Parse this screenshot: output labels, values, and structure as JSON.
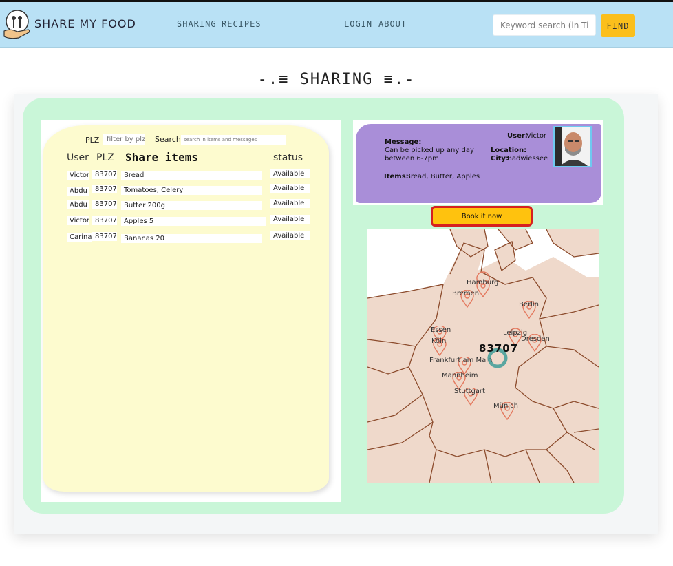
{
  "header": {
    "brand": "SHARE MY FOOD",
    "nav": [
      "SHARING",
      "RECIPES",
      "LOGIN",
      "ABOUT"
    ],
    "search_placeholder": "Keyword search (in Ti",
    "find_label": "FIND"
  },
  "page_title": "-.≡ SHARING ≡.-",
  "filters": {
    "plz_label": "PLZ",
    "plz_placeholder": "filter by plz",
    "search_label": "Search",
    "search_placeholder": "search in items and messages"
  },
  "table": {
    "headers": {
      "user": "User",
      "plz": "PLZ",
      "items": "Share  items",
      "status": "status"
    },
    "rows": [
      {
        "user": "Victor",
        "plz": "83707",
        "items": "Bread",
        "status": "Available"
      },
      {
        "user": "Abdu",
        "plz": "83707",
        "items": "Tomatoes, Celery",
        "status": "Available"
      },
      {
        "user": "Abdu",
        "plz": "83707",
        "items": "Butter 200g",
        "status": "Available"
      },
      {
        "user": "Victor",
        "plz": "83707",
        "items": "Apples 5",
        "status": "Available"
      },
      {
        "user": "Carina",
        "plz": "83707",
        "items": "Bananas  20",
        "status": "Available"
      }
    ]
  },
  "detail": {
    "message_label": "Message:",
    "message_line1": "Can be picked up any day",
    "message_line2": "between 6-7pm",
    "user_label": "User:",
    "user_value": "Victor",
    "location_label": "Location:",
    "city_label": "City:",
    "city_value": "Badwiessee",
    "items_label": "Items:",
    "items_value": "Bread, Butter, Apples",
    "book_label": "Book it now"
  },
  "map": {
    "plz": "83707",
    "cities": [
      "Hamburg",
      "Bremen",
      "Berlin",
      "Essen",
      "Köln",
      "Leipzig",
      "Dresden",
      "Frankfurt am Main",
      "Mannheim",
      "Stuttgart",
      "Münich"
    ],
    "colors": {
      "land": "#efd9cb",
      "border": "#8b4a2b",
      "pin": "#e4795f",
      "ring": "#5aa6a0"
    }
  },
  "colors": {
    "navbar": "#b9e1f5",
    "find": "#fbbf1c",
    "panel": "#c9f6d8",
    "card": "#fdfbcf",
    "purple": "#a98ed8"
  }
}
